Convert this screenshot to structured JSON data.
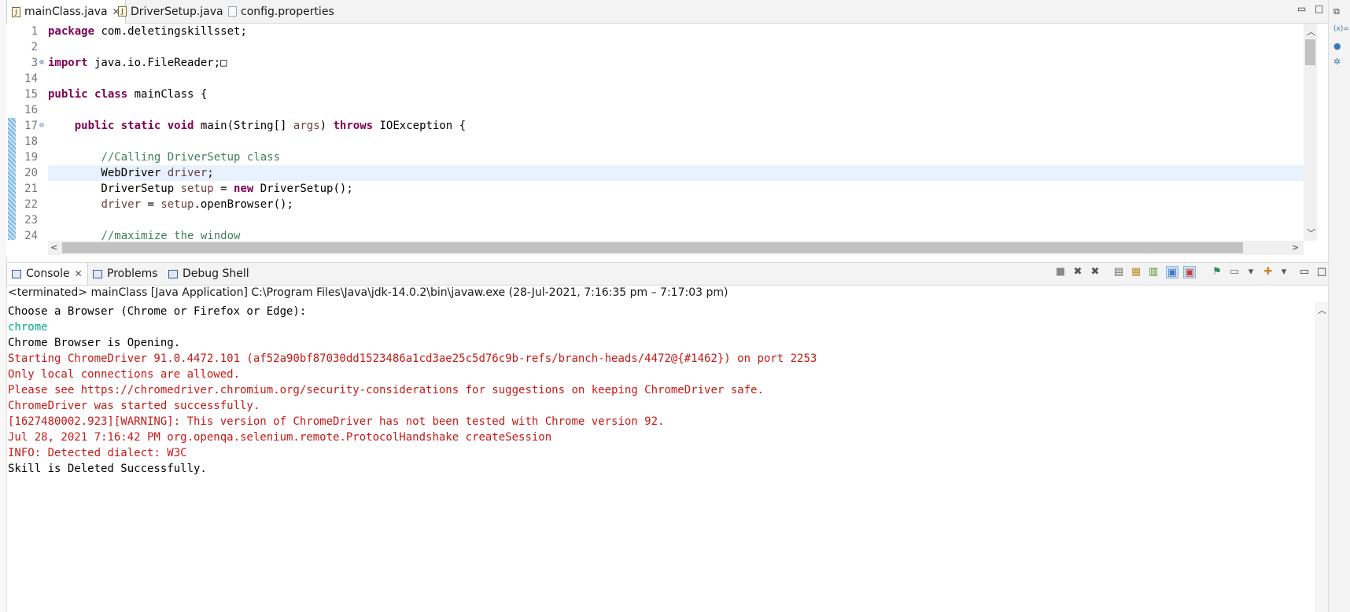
{
  "editor_tabs": [
    {
      "label": "mainClass.java",
      "active": true,
      "icon": "java-file-icon",
      "closable": true
    },
    {
      "label": "DriverSetup.java",
      "active": false,
      "icon": "java-file-icon"
    },
    {
      "label": "config.properties",
      "active": false,
      "icon": "properties-file-icon"
    }
  ],
  "window_controls": {
    "minimize": "▭",
    "maximize": "□"
  },
  "editor": {
    "lines": [
      {
        "num": "1",
        "tokens": [
          {
            "t": "package",
            "c": "kw"
          },
          {
            "t": " com.deletingskillsset;",
            "c": ""
          }
        ]
      },
      {
        "num": "2",
        "tokens": []
      },
      {
        "num": "3",
        "fold": "⊕",
        "tokens": [
          {
            "t": "import",
            "c": "kw"
          },
          {
            "t": " java.io.FileReader;",
            "c": ""
          },
          {
            "t": "□",
            "c": ""
          }
        ]
      },
      {
        "num": "14",
        "tokens": []
      },
      {
        "num": "15",
        "tokens": [
          {
            "t": "public",
            "c": "kw"
          },
          {
            "t": " ",
            "c": ""
          },
          {
            "t": "class",
            "c": "kw"
          },
          {
            "t": " mainClass {",
            "c": ""
          }
        ]
      },
      {
        "num": "16",
        "tokens": []
      },
      {
        "num": "17",
        "fold": "⊖",
        "tokens": [
          {
            "t": "    ",
            "c": ""
          },
          {
            "t": "public",
            "c": "kw"
          },
          {
            "t": " ",
            "c": ""
          },
          {
            "t": "static",
            "c": "kw"
          },
          {
            "t": " ",
            "c": ""
          },
          {
            "t": "void",
            "c": "kw"
          },
          {
            "t": " main(String[] ",
            "c": ""
          },
          {
            "t": "args",
            "c": "var"
          },
          {
            "t": ") ",
            "c": ""
          },
          {
            "t": "throws",
            "c": "kw"
          },
          {
            "t": " IOException {",
            "c": ""
          }
        ]
      },
      {
        "num": "18",
        "tokens": []
      },
      {
        "num": "19",
        "tokens": [
          {
            "t": "        ",
            "c": ""
          },
          {
            "t": "//Calling DriverSetup class",
            "c": "cm"
          }
        ]
      },
      {
        "num": "20",
        "tokens": [
          {
            "t": "        WebDriver ",
            "c": ""
          },
          {
            "t": "driver",
            "c": "var"
          },
          {
            "t": ";",
            "c": ""
          }
        ]
      },
      {
        "num": "21",
        "tokens": [
          {
            "t": "        DriverSetup ",
            "c": ""
          },
          {
            "t": "setup",
            "c": "var"
          },
          {
            "t": " = ",
            "c": ""
          },
          {
            "t": "new",
            "c": "kw"
          },
          {
            "t": " DriverSetup();",
            "c": ""
          }
        ]
      },
      {
        "num": "22",
        "tokens": [
          {
            "t": "        ",
            "c": ""
          },
          {
            "t": "driver",
            "c": "var"
          },
          {
            "t": " = ",
            "c": ""
          },
          {
            "t": "setup",
            "c": "var"
          },
          {
            "t": ".openBrowser();",
            "c": ""
          }
        ]
      },
      {
        "num": "23",
        "tokens": []
      },
      {
        "num": "24",
        "tokens": [
          {
            "t": "        ",
            "c": ""
          },
          {
            "t": "//maximize the window",
            "c": "cm"
          }
        ]
      }
    ]
  },
  "console_tabs": [
    {
      "label": "Console",
      "active": true,
      "closable": true,
      "icon": "console-icon"
    },
    {
      "label": "Problems",
      "active": false,
      "icon": "problems-icon"
    },
    {
      "label": "Debug Shell",
      "active": false,
      "icon": "debug-shell-icon"
    }
  ],
  "console": {
    "status": "<terminated> mainClass [Java Application] C:\\Program Files\\Java\\jdk-14.0.2\\bin\\javaw.exe  (28-Jul-2021, 7:16:35 pm – 7:17:03 pm)",
    "lines": [
      {
        "text": "Choose a Browser (Chrome or Firefox or Edge):",
        "color": "#000000"
      },
      {
        "text": "chrome",
        "color": "#00a884"
      },
      {
        "text": "Chrome Browser is Opening.",
        "color": "#000000"
      },
      {
        "text": "Starting ChromeDriver 91.0.4472.101 (af52a90bf87030dd1523486a1cd3ae25c5d76c9b-refs/branch-heads/4472@{#1462}) on port 2253",
        "color": "#c41a16"
      },
      {
        "text": "Only local connections are allowed.",
        "color": "#c41a16"
      },
      {
        "text": "Please see https://chromedriver.chromium.org/security-considerations for suggestions on keeping ChromeDriver safe.",
        "color": "#c41a16"
      },
      {
        "text": "ChromeDriver was started successfully.",
        "color": "#c41a16"
      },
      {
        "text": "[1627480002.923][WARNING]: This version of ChromeDriver has not been tested with Chrome version 92.",
        "color": "#c41a16"
      },
      {
        "text": "Jul 28, 2021 7:16:42 PM org.openqa.selenium.remote.ProtocolHandshake createSession",
        "color": "#c41a16"
      },
      {
        "text": "INFO: Detected dialect: W3C",
        "color": "#c41a16"
      },
      {
        "text": "Skill is Deleted Successfully.",
        "color": "#000000"
      }
    ]
  },
  "console_toolbar": [
    {
      "icon": "terminate-icon",
      "glyph": "■"
    },
    {
      "icon": "remove-launch-icon",
      "glyph": "✖"
    },
    {
      "icon": "remove-all-icon",
      "glyph": "✖"
    },
    {
      "icon": "clear-console-icon",
      "glyph": "▤"
    },
    {
      "icon": "scroll-lock-icon",
      "glyph": "▦"
    },
    {
      "icon": "word-wrap-icon",
      "glyph": "▥"
    },
    {
      "icon": "show-on-stdout-icon",
      "glyph": "▣"
    },
    {
      "icon": "show-on-stderr-icon",
      "glyph": "▣"
    },
    {
      "icon": "pin-console-icon",
      "glyph": "⚑"
    },
    {
      "icon": "display-console-icon",
      "glyph": "▭"
    },
    {
      "icon": "display-dropdown-icon",
      "glyph": "▾"
    },
    {
      "icon": "open-console-icon",
      "glyph": "✚"
    },
    {
      "icon": "open-console-dropdown-icon",
      "glyph": "▾"
    },
    {
      "icon": "minimize-icon",
      "glyph": "▭"
    },
    {
      "icon": "maximize-icon",
      "glyph": "□"
    }
  ],
  "right_trim": [
    {
      "icon": "restore-icon",
      "glyph": "⧉"
    },
    {
      "icon": "variables-icon",
      "glyph": "(x)="
    },
    {
      "icon": "breakpoints-icon",
      "glyph": "●"
    },
    {
      "icon": "expressions-icon",
      "glyph": "✲"
    }
  ]
}
